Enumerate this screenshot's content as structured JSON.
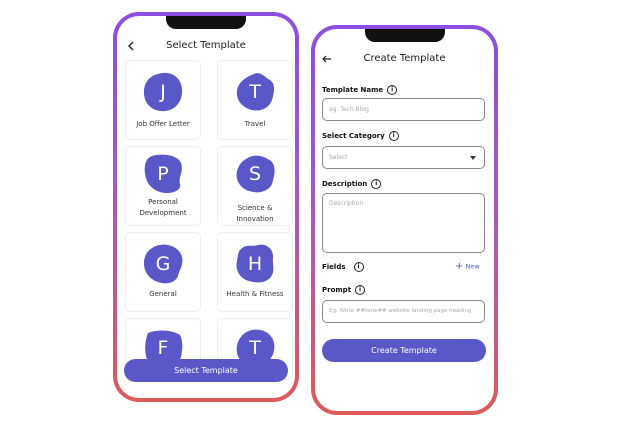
{
  "select_screen": {
    "title": "Select Template",
    "cards": [
      {
        "letter": "J",
        "label": "Job Offer Letter"
      },
      {
        "letter": "T",
        "label": "Travel"
      },
      {
        "letter": "P",
        "label": "Personal Development"
      },
      {
        "letter": "S",
        "label": "Science & Innovation"
      },
      {
        "letter": "G",
        "label": "General"
      },
      {
        "letter": "H",
        "label": "Health & Fitness"
      },
      {
        "letter": "F",
        "label": ""
      },
      {
        "letter": "T",
        "label": ""
      }
    ],
    "button_label": "Select Template"
  },
  "create_screen": {
    "title": "Create Template",
    "template_name_label": "Template Name",
    "template_name_placeholder": "eg. Tech Blog",
    "category_label": "Select Category",
    "category_value": "Select",
    "description_label": "Description",
    "description_placeholder": "Description",
    "fields_label": "Fields",
    "new_label": "New",
    "prompt_label": "Prompt",
    "prompt_placeholder": "Eg: Write ##tone## website landing page heading",
    "button_label": "Create Template"
  },
  "colors": {
    "accent": "#5a57c8",
    "frame_top": "#8a4ee0",
    "frame_bottom": "#de5a5a"
  }
}
